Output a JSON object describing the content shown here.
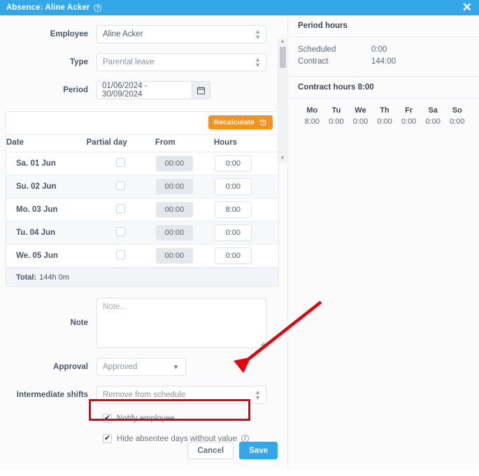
{
  "window": {
    "title": "Absence: Aline Acker",
    "help_icon": "question-circle-icon",
    "close_icon": "close-icon"
  },
  "form": {
    "employee": {
      "label": "Employee",
      "value": "Aline Acker"
    },
    "type": {
      "label": "Type",
      "value": "Parental leave"
    },
    "period": {
      "label": "Period",
      "value": "01/06/2024 - 30/09/2024",
      "icon": "calendar-icon"
    },
    "note": {
      "label": "Note",
      "value": "",
      "placeholder": "Note..."
    },
    "approval": {
      "label": "Approval",
      "value": "Approved"
    },
    "intermediate_shifts": {
      "label": "Intermediate shifts",
      "value": "Remove from schedule"
    }
  },
  "table": {
    "recalculate_label": "Recalculate",
    "recalculate_icon": "history-refresh-icon",
    "columns": [
      "Date",
      "Partial day",
      "From",
      "Hours"
    ],
    "rows": [
      {
        "date": "Sa. 01 Jun",
        "partial_day": false,
        "from": "00:00",
        "hours": "0:00"
      },
      {
        "date": "Su. 02 Jun",
        "partial_day": false,
        "from": "00:00",
        "hours": "0:00"
      },
      {
        "date": "Mo. 03 Jun",
        "partial_day": false,
        "from": "00:00",
        "hours": "8:00"
      },
      {
        "date": "Tu. 04 Jun",
        "partial_day": false,
        "from": "00:00",
        "hours": "0:00"
      },
      {
        "date": "We. 05 Jun",
        "partial_day": false,
        "from": "00:00",
        "hours": "0:00"
      }
    ],
    "total_label": "Total:",
    "total_value": "144h 0m"
  },
  "checkboxes": {
    "notify_employee": {
      "label": "Notify employee",
      "checked": true
    },
    "hide_absentee_days": {
      "label": "Hide absentee days without value",
      "checked": true,
      "info_icon": "info-circle-icon"
    }
  },
  "footer": {
    "cancel_label": "Cancel",
    "save_label": "Save"
  },
  "panel": {
    "period_hours": {
      "title": "Period hours",
      "rows": [
        {
          "label": "Scheduled",
          "value": "0:00"
        },
        {
          "label": "Contract",
          "value": "144:00"
        }
      ]
    },
    "contract_hours": {
      "title": "Contract hours 8:00",
      "days": [
        {
          "name": "Mo",
          "value": "8:00"
        },
        {
          "name": "Tu",
          "value": "0:00"
        },
        {
          "name": "We",
          "value": "0:00"
        },
        {
          "name": "Th",
          "value": "0:00"
        },
        {
          "name": "Fr",
          "value": "0:00"
        },
        {
          "name": "Sa",
          "value": "0:00"
        },
        {
          "name": "So",
          "value": "0:00"
        }
      ]
    }
  },
  "colors": {
    "header_blue": "#33a7e8",
    "recalculate_orange": "#f6921e",
    "save_blue": "#33a7e8",
    "annotation_red": "#e8000b"
  }
}
